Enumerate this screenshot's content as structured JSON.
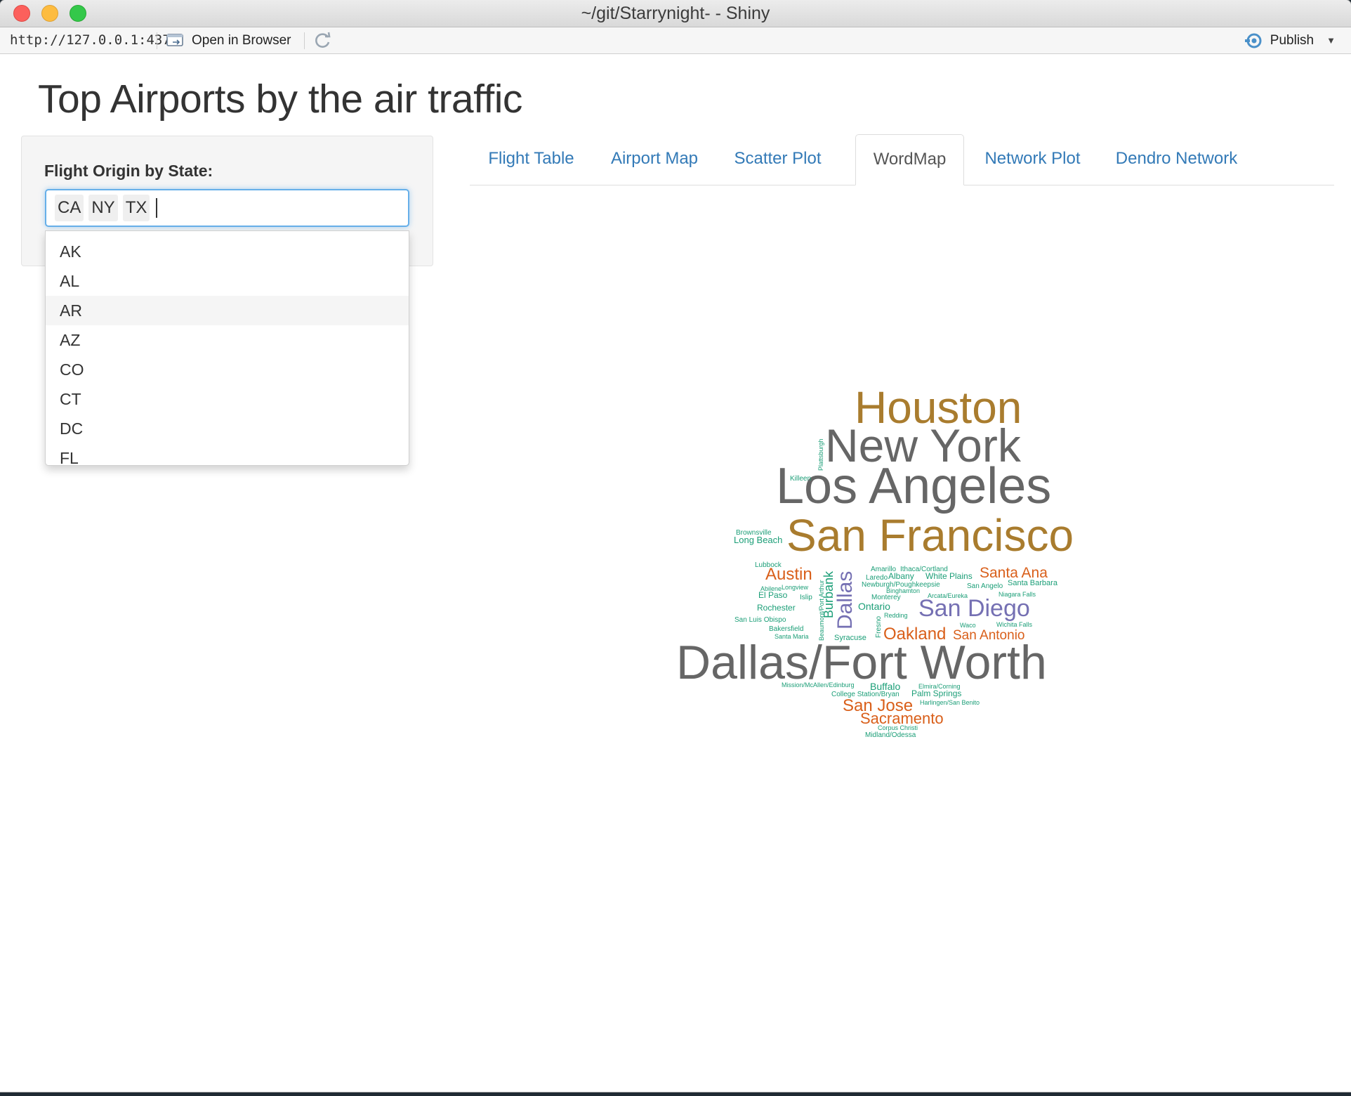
{
  "window": {
    "title": "~/git/Starrynight- - Shiny"
  },
  "toolbar": {
    "url": "http://127.0.0.1:4376",
    "open_in_browser": "Open in Browser",
    "publish": "Publish"
  },
  "page": {
    "title": "Top Airports by the air traffic"
  },
  "filter": {
    "label": "Flight Origin by State:",
    "selected": [
      "CA",
      "NY",
      "TX"
    ],
    "options": [
      "AK",
      "AL",
      "AR",
      "AZ",
      "CO",
      "CT",
      "DC",
      "FL"
    ],
    "highlighted": "AR"
  },
  "tabs": [
    "Flight Table",
    "Airport Map",
    "Scatter Plot",
    "WordMap",
    "Network Plot",
    "Dendro Network"
  ],
  "active_tab": "WordMap",
  "colors": {
    "gray": "#666666",
    "gold": "#a97c2e",
    "orange": "#d95f1a",
    "purple": "#7570b3",
    "green": "#1b9e77",
    "link": "#337ab7"
  },
  "wordcloud": {
    "words": [
      "Houston",
      "New York",
      "Los Angeles",
      "San Francisco",
      "Dallas/Fort Worth",
      "Dallas",
      "San Diego",
      "Austin",
      "San Jose",
      "Sacramento",
      "Oakland",
      "San Antonio",
      "Santa Ana",
      "Burbank",
      "Ontario",
      "Long Beach",
      "Brownsville",
      "Lubbock",
      "El Paso",
      "Rochester",
      "San Luis Obispo",
      "Bakersfield",
      "Santa Maria",
      "Syracuse",
      "Killeen",
      "Plattsburgh",
      "Amarillo",
      "Ithaca/Cortland",
      "Laredo",
      "Albany",
      "White Plains",
      "Newburgh/Poughkeepsie",
      "Binghamton",
      "San Angelo",
      "Santa Barbara",
      "Abilene",
      "Longview",
      "Islip",
      "Monterey",
      "Arcata/Eureka",
      "Niagara Falls",
      "Redding",
      "Fresno",
      "Beaumont/Port Arthur",
      "Waco",
      "Wichita Falls",
      "Mission/McAllen/Edinburg",
      "Buffalo",
      "Elmira/Corning",
      "College Station/Bryan",
      "Palm Springs",
      "Harlingen/San Benito",
      "Corpus Christi",
      "Midland/Odessa"
    ]
  }
}
